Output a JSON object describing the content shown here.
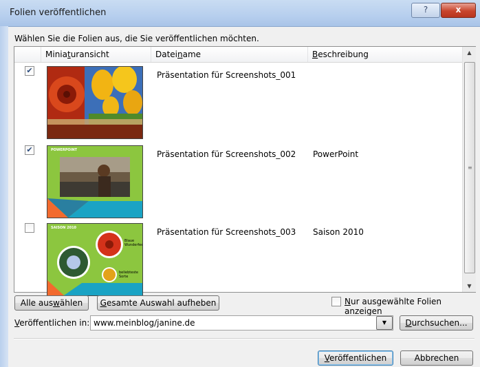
{
  "window": {
    "title": "Folien veröffentlichen",
    "help_glyph": "?",
    "close_glyph": "x"
  },
  "prompt": "Wählen Sie die Folien aus, die Sie veröffentlichen möchten.",
  "columns": {
    "thumbnail_pre": "Minia",
    "thumbnail_u": "t",
    "thumbnail_post": "uransicht",
    "filename_pre": "Datei",
    "filename_u": "n",
    "filename_post": "ame",
    "description_pre": "",
    "description_u": "B",
    "description_post": "eschreibung"
  },
  "rows": [
    {
      "checked": true,
      "check_glyph": "✔",
      "filename": "Präsentation für Screenshots_001",
      "description": "",
      "thumb_caption": ""
    },
    {
      "checked": true,
      "check_glyph": "✔",
      "filename": "Präsentation für Screenshots_002",
      "description": "PowerPoint",
      "thumb_title": "POWERPOINT"
    },
    {
      "checked": false,
      "check_glyph": "",
      "filename": "Präsentation für Screenshots_003",
      "description": "Saison 2010",
      "thumb_title": "SAISON 2010",
      "thumb_text1": "Blaue Wunderfeelt",
      "thumb_text2": "beliebteste Sorte"
    }
  ],
  "buttons": {
    "select_all_pre": "Alle aus",
    "select_all_u": "w",
    "select_all_post": "ählen",
    "clear_pre": "",
    "clear_u": "G",
    "clear_post": "esamte Auswahl aufheben",
    "browse_pre": "",
    "browse_u": "D",
    "browse_post": "urchsuchen...",
    "publish_pre": "",
    "publish_u": "V",
    "publish_post": "eröffentlichen",
    "cancel": "Abbrechen"
  },
  "only_selected": {
    "checked": false,
    "pre": "",
    "u": "N",
    "post": "ur ausgewählte Folien anzeigen"
  },
  "publish_to": {
    "label_pre": "",
    "label_u": "V",
    "label_post": "eröffentlichen in:",
    "value": "www.meinblog/janine.de"
  },
  "icons": {
    "scroll_up": "▲",
    "scroll_down": "▼",
    "dropdown": "▼",
    "grip": "≡"
  },
  "colors": {
    "title_bar": "#b7cfee",
    "close_button": "#c8452c",
    "accent_check": "#2a4b7c"
  }
}
